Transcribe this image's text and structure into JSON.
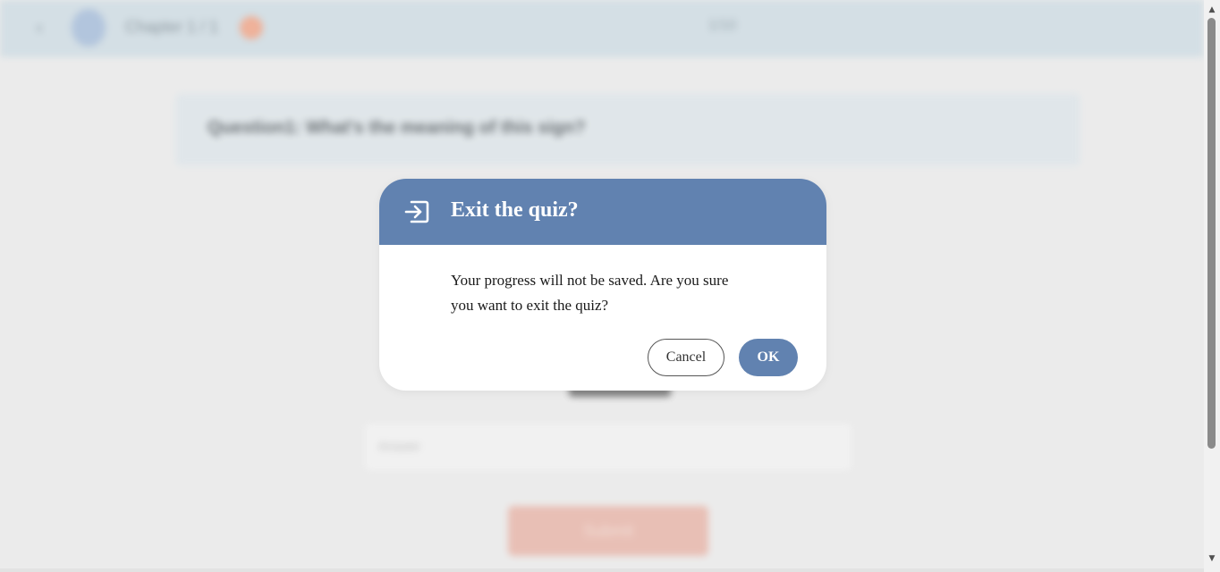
{
  "background": {
    "header": {
      "back_icon": "chevron-left-icon",
      "chapter_label": "Chapter 1 / 1",
      "score_label": "1/10"
    },
    "question": {
      "text": "Question1: What's the meaning of this sign?"
    },
    "answer_input": {
      "placeholder": "Answer"
    },
    "submit_label": "Submit"
  },
  "dialog": {
    "icon": "exit-icon",
    "title": "Exit the quiz?",
    "message": "Your progress will not be saved. Are you sure you want to exit the quiz?",
    "cancel_label": "Cancel",
    "ok_label": "OK"
  },
  "colors": {
    "accent": "#6182b0",
    "header_bg": "#d0dde4",
    "submit_bg": "#e8b8ac"
  }
}
